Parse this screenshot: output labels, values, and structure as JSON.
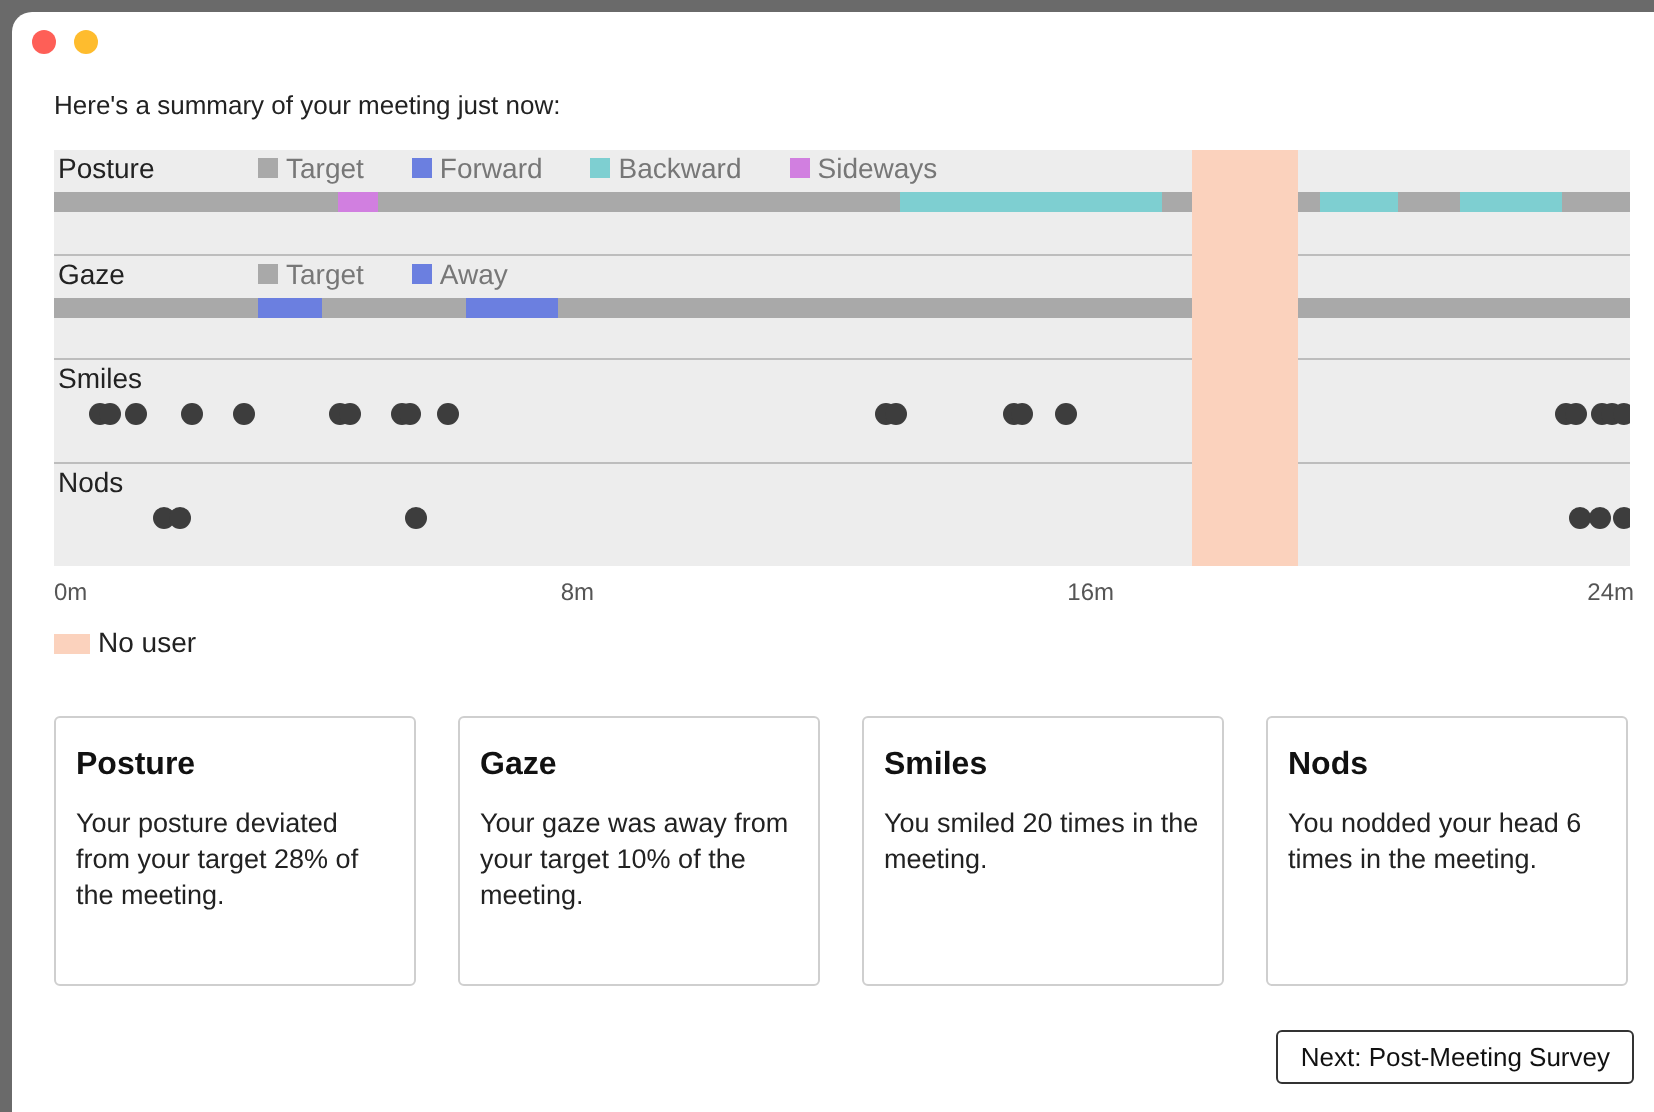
{
  "window": {
    "controls": [
      {
        "kind": "close"
      },
      {
        "kind": "minimize"
      }
    ]
  },
  "heading": "Here's a summary of your meeting just now:",
  "tracks": [
    {
      "label": "Posture",
      "kind": "bar",
      "legend": [
        {
          "label": "Target",
          "color": "#a9a9a9"
        },
        {
          "label": "Forward",
          "color": "#6b7fe0"
        },
        {
          "label": "Backward",
          "color": "#7ecfd1"
        },
        {
          "label": "Sideways",
          "color": "#d17fe0"
        }
      ]
    },
    {
      "label": "Gaze",
      "kind": "bar",
      "legend": [
        {
          "label": "Target",
          "color": "#a9a9a9"
        },
        {
          "label": "Away",
          "color": "#6b7fe0"
        }
      ]
    },
    {
      "label": "Smiles",
      "kind": "dots"
    },
    {
      "label": "Nods",
      "kind": "dots"
    }
  ],
  "axis_ticks": [
    "0m",
    "8m",
    "16m",
    "24m"
  ],
  "no_user_legend": {
    "label": "No user",
    "color": "#fbd2bd"
  },
  "cards": [
    {
      "title": "Posture",
      "text": "Your posture deviated from your target 28% of the meeting."
    },
    {
      "title": "Gaze",
      "text": "Your gaze was away from your target 10% of the meeting."
    },
    {
      "title": "Smiles",
      "text": "You smiled 20 times in the meeting."
    },
    {
      "title": "Nods",
      "text": "You nodded your head 6 times in the meeting."
    }
  ],
  "button": "Next: Post-Meeting Survey"
}
